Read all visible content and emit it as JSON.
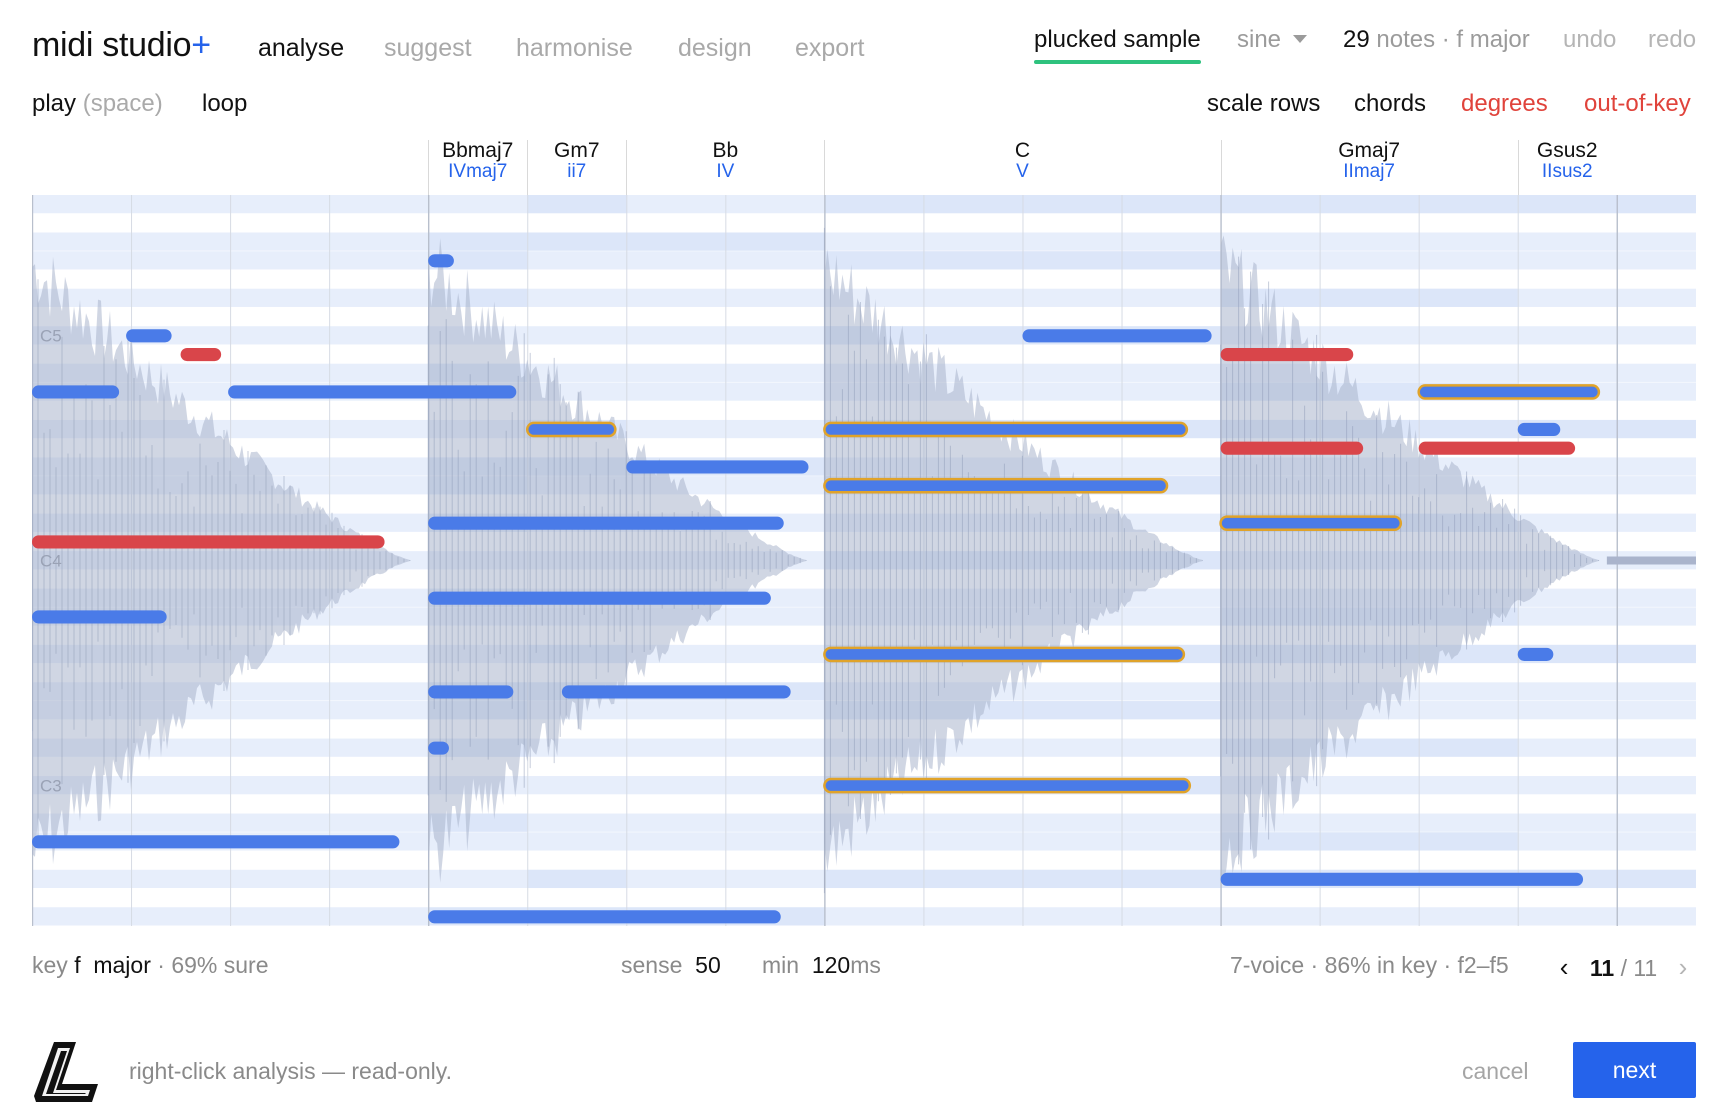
{
  "app": {
    "name": "midi studio",
    "name_suffix": "+"
  },
  "modes": [
    {
      "label": "analyse",
      "active": true
    },
    {
      "label": "suggest",
      "active": false
    },
    {
      "label": "harmonise",
      "active": false
    },
    {
      "label": "design",
      "active": false
    },
    {
      "label": "export",
      "active": false
    }
  ],
  "toolbar": {
    "sample_tab": "plucked sample",
    "synth_select": "sine",
    "note_count": "29",
    "note_count_suffix": "notes · f major",
    "undo": "undo",
    "redo": "redo"
  },
  "transport": {
    "play": "play",
    "play_hint": "(space)",
    "loop": "loop"
  },
  "view_toggles": {
    "scale_rows": "scale rows",
    "chords": "chords",
    "degrees": "degrees",
    "out_of_key": "out-of-key"
  },
  "chords": [
    {
      "name": "Bbmaj7",
      "degree": "IVmaj7",
      "start": 4.0
    },
    {
      "name": "Gm7",
      "degree": "ii7",
      "start": 5.0
    },
    {
      "name": "Bb",
      "degree": "IV",
      "start": 6.0
    },
    {
      "name": "C",
      "degree": "V",
      "start": 8.0
    },
    {
      "name": "Gmaj7",
      "degree": "IImaj7",
      "start": 12.0
    },
    {
      "name": "Gsus2",
      "degree": "IIsus2",
      "start": 15.0
    }
  ],
  "piano_roll": {
    "beats": 16.8,
    "grid_beats": 16,
    "bar_beats": 4,
    "midi_low": 41,
    "midi_high": 79,
    "scale_pitch_classes": [
      5,
      7,
      9,
      10,
      0,
      2,
      4
    ],
    "octave_labels": [
      {
        "label": "C5",
        "midi": 72
      },
      {
        "label": "C4",
        "midi": 60
      },
      {
        "label": "C3",
        "midi": 48
      }
    ],
    "colors": {
      "in_key": "#4a7be8",
      "out_of_key": "#d9454a",
      "chord_outline": "#e0a32a",
      "row_scale": "#e7eefb",
      "row_chord": "#d4e0f7",
      "waveform": "#aab4cc"
    },
    "notes": [
      {
        "midi": 76,
        "start": 4.0,
        "dur": 0.3,
        "kind": "in"
      },
      {
        "midi": 72,
        "start": 0.95,
        "dur": 0.5,
        "kind": "in"
      },
      {
        "midi": 71,
        "start": 1.5,
        "dur": 0.45,
        "kind": "out"
      },
      {
        "midi": 69,
        "start": 0.0,
        "dur": 0.92,
        "kind": "in"
      },
      {
        "midi": 69,
        "start": 1.98,
        "dur": 2.95,
        "kind": "in"
      },
      {
        "midi": 61,
        "start": 0.0,
        "dur": 3.6,
        "kind": "out"
      },
      {
        "midi": 57,
        "start": 0.0,
        "dur": 1.4,
        "kind": "in"
      },
      {
        "midi": 45,
        "start": 0.0,
        "dur": 3.75,
        "kind": "in"
      },
      {
        "midi": 67,
        "start": 5.0,
        "dur": 0.93,
        "kind": "chord"
      },
      {
        "midi": 65,
        "start": 6.0,
        "dur": 1.88,
        "kind": "in"
      },
      {
        "midi": 62,
        "start": 4.0,
        "dur": 3.63,
        "kind": "in"
      },
      {
        "midi": 58,
        "start": 4.0,
        "dur": 3.5,
        "kind": "in"
      },
      {
        "midi": 53,
        "start": 4.0,
        "dur": 0.9,
        "kind": "in"
      },
      {
        "midi": 53,
        "start": 5.35,
        "dur": 2.35,
        "kind": "in"
      },
      {
        "midi": 50,
        "start": 4.0,
        "dur": 0.25,
        "kind": "in"
      },
      {
        "midi": 41,
        "start": 4.0,
        "dur": 3.6,
        "kind": "in"
      },
      {
        "midi": 72,
        "start": 10.0,
        "dur": 1.95,
        "kind": "in"
      },
      {
        "midi": 67,
        "start": 8.0,
        "dur": 3.7,
        "kind": "chord"
      },
      {
        "midi": 64,
        "start": 8.0,
        "dur": 3.5,
        "kind": "chord"
      },
      {
        "midi": 55,
        "start": 8.0,
        "dur": 3.67,
        "kind": "chord"
      },
      {
        "midi": 48,
        "start": 8.0,
        "dur": 3.73,
        "kind": "chord"
      },
      {
        "midi": 71,
        "start": 12.0,
        "dur": 1.38,
        "kind": "out"
      },
      {
        "midi": 69,
        "start": 14.0,
        "dur": 1.86,
        "kind": "chord"
      },
      {
        "midi": 67,
        "start": 15.0,
        "dur": 0.47,
        "kind": "in"
      },
      {
        "midi": 66,
        "start": 12.0,
        "dur": 1.48,
        "kind": "out"
      },
      {
        "midi": 66,
        "start": 14.0,
        "dur": 1.62,
        "kind": "out"
      },
      {
        "midi": 62,
        "start": 12.0,
        "dur": 1.86,
        "kind": "chord"
      },
      {
        "midi": 55,
        "start": 15.0,
        "dur": 0.4,
        "kind": "in"
      },
      {
        "midi": 43,
        "start": 12.0,
        "dur": 3.7,
        "kind": "in"
      }
    ]
  },
  "status": {
    "key_label": "key",
    "key_root": "f",
    "key_mode": "major",
    "key_confidence": "· 69% sure",
    "sense_label": "sense",
    "sense_value": "50",
    "min_label": "min",
    "min_value": "120",
    "min_unit": "ms",
    "voicing_summary": "7-voice · 86% in key · f2–f5",
    "page_current": "11",
    "page_total": "/ 11",
    "prev_icon": "‹",
    "next_icon": "›"
  },
  "footer": {
    "hint": "right-click analysis — read-only.",
    "cancel": "cancel",
    "next": "next"
  }
}
